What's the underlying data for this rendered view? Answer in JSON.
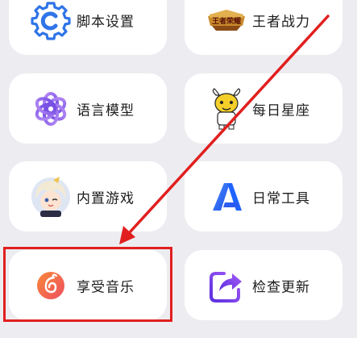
{
  "grid": {
    "items": [
      {
        "label": "脚本设置",
        "icon": "gear-c-icon"
      },
      {
        "label": "王者战力",
        "icon": "honor-of-kings-logo-icon"
      },
      {
        "label": "语言模型",
        "icon": "openai-knot-icon"
      },
      {
        "label": "每日星座",
        "icon": "cartoon-ox-icon"
      },
      {
        "label": "内置游戏",
        "icon": "anime-avatar-icon"
      },
      {
        "label": "日常工具",
        "icon": "blue-a-logo-icon"
      },
      {
        "label": "享受音乐",
        "icon": "netease-music-icon"
      },
      {
        "label": "检查更新",
        "icon": "share-arrow-icon"
      }
    ]
  },
  "annotation": {
    "highlight_color": "#e11f1f",
    "highlighted_item": "享受音乐",
    "logo_text": "王者荣耀"
  },
  "colors": {
    "background": "#ededf1",
    "card": "#ffffff",
    "gear_blue": "#2f74e8",
    "music_orange": "#f36b3a",
    "tool_blue": "#1f64ff",
    "update_purple": "#6a3df0"
  }
}
